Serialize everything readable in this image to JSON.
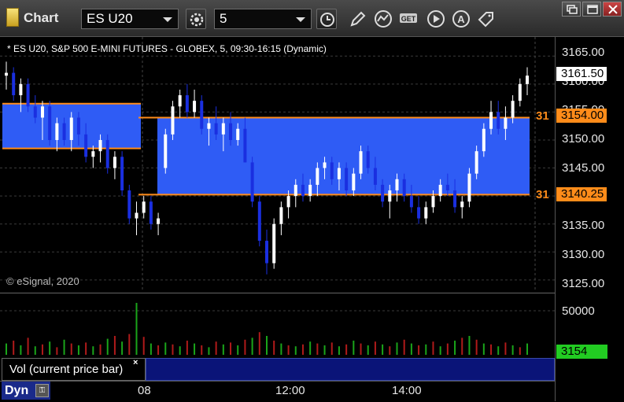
{
  "window": {
    "title": "Chart",
    "symbol": "ES U20",
    "interval": "5"
  },
  "toolbar": {
    "icons": [
      "gear-icon",
      "clock-icon",
      "pencil-icon",
      "study-icon",
      "get-icon",
      "play-icon",
      "alert-icon",
      "tag-icon"
    ]
  },
  "window_controls": [
    "restore-icon",
    "maximize-icon",
    "close-icon"
  ],
  "chart_header": "* ES U20, S&P 500 E-MINI FUTURES - GLOBEX, 5, 09:30-16:15 (Dynamic)",
  "watermark": "© eSignal, 2020",
  "price_axis": {
    "ticks": [
      "3165.00",
      "3160.00",
      "3155.00",
      "3150.00",
      "3145.00",
      "3140.00",
      "3135.00",
      "3130.00",
      "3125.00"
    ],
    "current_price": "3161.50",
    "level_high": "3154.00",
    "level_low": "3140.25",
    "level_left_high": "31",
    "level_left_low": "31"
  },
  "volume": {
    "label": "Vol (current price bar)",
    "close_glyph": "×",
    "tick": "50000",
    "current": "3154"
  },
  "time_axis": {
    "labels": [
      "08",
      "12:00",
      "14:00"
    ],
    "mode_label": "Dyn",
    "mode_icon": "lock-icon"
  },
  "colors": {
    "up": "#ffffff",
    "down": "#1a2fe0",
    "zone": "#2f5cf5",
    "level_line": "#ff8c1a",
    "vol_up": "#1aa51a",
    "vol_down": "#b01a1a",
    "current_price_bg": "#ffffff",
    "level_box_bg": "#ff8c1a",
    "vol_box_bg": "#22cc22"
  },
  "chart_data": {
    "type": "candlestick",
    "ylim": [
      3124,
      3167
    ],
    "zones": [
      {
        "top": 3156.5,
        "bottom": 3148.5,
        "segment": "prior"
      },
      {
        "top": 3154.0,
        "bottom": 3140.25,
        "segment": "current"
      }
    ],
    "candles": [
      [
        3161.5,
        3164,
        3159,
        3162
      ],
      [
        3162,
        3163,
        3157,
        3158
      ],
      [
        3158,
        3161,
        3155,
        3160
      ],
      [
        3160,
        3161,
        3155,
        3156
      ],
      [
        3156,
        3158,
        3153,
        3154
      ],
      [
        3154,
        3157,
        3150,
        3156
      ],
      [
        3156,
        3157,
        3149,
        3150
      ],
      [
        3150,
        3154,
        3148,
        3153
      ],
      [
        3153,
        3154,
        3149,
        3150
      ],
      [
        3150,
        3155,
        3148,
        3154
      ],
      [
        3154,
        3155,
        3149,
        3151
      ],
      [
        3151,
        3153,
        3146,
        3147
      ],
      [
        3147,
        3149,
        3145,
        3148
      ],
      [
        3148,
        3151,
        3146,
        3150
      ],
      [
        3150,
        3151,
        3144,
        3145
      ],
      [
        3145,
        3148,
        3143,
        3147
      ],
      [
        3147,
        3148,
        3140,
        3141
      ],
      [
        3141,
        3142,
        3135,
        3136
      ],
      [
        3136,
        3139,
        3133,
        3137
      ],
      [
        3137,
        3140,
        3136,
        3139
      ],
      [
        3139,
        3140,
        3134,
        3135
      ],
      [
        3135,
        3137,
        3133,
        3136
      ],
      [
        3145,
        3152,
        3144,
        3151
      ],
      [
        3151,
        3157,
        3150,
        3156
      ],
      [
        3156,
        3159,
        3154,
        3158
      ],
      [
        3158,
        3160,
        3154,
        3155
      ],
      [
        3155,
        3159,
        3154,
        3157
      ],
      [
        3157,
        3158,
        3151,
        3152
      ],
      [
        3152,
        3154,
        3149,
        3153
      ],
      [
        3153,
        3156,
        3150,
        3151
      ],
      [
        3151,
        3154,
        3148,
        3153
      ],
      [
        3153,
        3155,
        3149,
        3150
      ],
      [
        3150,
        3153,
        3149,
        3152
      ],
      [
        3152,
        3154,
        3146,
        3146
      ],
      [
        3146,
        3147,
        3138,
        3139
      ],
      [
        3139,
        3140,
        3131,
        3132
      ],
      [
        3132,
        3134,
        3126,
        3128
      ],
      [
        3128,
        3136,
        3127,
        3135
      ],
      [
        3135,
        3139,
        3133,
        3138
      ],
      [
        3138,
        3141,
        3136,
        3140
      ],
      [
        3140,
        3143,
        3138,
        3142
      ],
      [
        3142,
        3144,
        3139,
        3140
      ],
      [
        3140,
        3143,
        3139,
        3142
      ],
      [
        3142,
        3146,
        3140,
        3145
      ],
      [
        3145,
        3147,
        3143,
        3146
      ],
      [
        3146,
        3147,
        3142,
        3143
      ],
      [
        3143,
        3146,
        3141,
        3145
      ],
      [
        3145,
        3146,
        3140,
        3141
      ],
      [
        3141,
        3145,
        3140,
        3144
      ],
      [
        3144,
        3149,
        3143,
        3148
      ],
      [
        3148,
        3149,
        3144,
        3145
      ],
      [
        3145,
        3147,
        3141,
        3142
      ],
      [
        3142,
        3143,
        3138,
        3139
      ],
      [
        3139,
        3142,
        3136,
        3141
      ],
      [
        3141,
        3144,
        3139,
        3143
      ],
      [
        3143,
        3144,
        3139,
        3140
      ],
      [
        3140,
        3142,
        3137,
        3138
      ],
      [
        3138,
        3140,
        3135,
        3136
      ],
      [
        3136,
        3139,
        3135,
        3138
      ],
      [
        3138,
        3141,
        3137,
        3140
      ],
      [
        3140,
        3143,
        3139,
        3142
      ],
      [
        3142,
        3144,
        3140,
        3141
      ],
      [
        3141,
        3143,
        3137,
        3138
      ],
      [
        3138,
        3140,
        3136,
        3139
      ],
      [
        3139,
        3145,
        3138,
        3144
      ],
      [
        3144,
        3149,
        3143,
        3148
      ],
      [
        3148,
        3153,
        3147,
        3152
      ],
      [
        3152,
        3157,
        3151,
        3155
      ],
      [
        3155,
        3157,
        3151,
        3152
      ],
      [
        3152,
        3156,
        3150,
        3154
      ],
      [
        3154,
        3158,
        3153,
        3157
      ],
      [
        3157,
        3161,
        3156,
        3160
      ],
      [
        3160,
        3163,
        3158,
        3161.5
      ]
    ],
    "volume": [
      [
        12,
        1
      ],
      [
        15,
        0
      ],
      [
        10,
        1
      ],
      [
        18,
        0
      ],
      [
        9,
        1
      ],
      [
        11,
        0
      ],
      [
        14,
        1
      ],
      [
        8,
        0
      ],
      [
        16,
        1
      ],
      [
        12,
        0
      ],
      [
        10,
        1
      ],
      [
        13,
        0
      ],
      [
        9,
        1
      ],
      [
        11,
        0
      ],
      [
        17,
        1
      ],
      [
        20,
        0
      ],
      [
        14,
        1
      ],
      [
        22,
        0
      ],
      [
        55,
        1
      ],
      [
        19,
        0
      ],
      [
        12,
        1
      ],
      [
        10,
        0
      ],
      [
        13,
        1
      ],
      [
        11,
        0
      ],
      [
        9,
        1
      ],
      [
        15,
        0
      ],
      [
        12,
        1
      ],
      [
        10,
        0
      ],
      [
        8,
        1
      ],
      [
        14,
        0
      ],
      [
        11,
        1
      ],
      [
        13,
        0
      ],
      [
        10,
        1
      ],
      [
        16,
        0
      ],
      [
        18,
        1
      ],
      [
        24,
        0
      ],
      [
        20,
        1
      ],
      [
        15,
        0
      ],
      [
        12,
        1
      ],
      [
        10,
        0
      ],
      [
        9,
        1
      ],
      [
        11,
        0
      ],
      [
        14,
        1
      ],
      [
        12,
        0
      ],
      [
        10,
        1
      ],
      [
        13,
        0
      ],
      [
        9,
        1
      ],
      [
        11,
        0
      ],
      [
        15,
        1
      ],
      [
        12,
        0
      ],
      [
        10,
        1
      ],
      [
        14,
        0
      ],
      [
        11,
        1
      ],
      [
        9,
        0
      ],
      [
        13,
        1
      ],
      [
        16,
        0
      ],
      [
        12,
        1
      ],
      [
        10,
        0
      ],
      [
        11,
        1
      ],
      [
        14,
        0
      ],
      [
        9,
        1
      ],
      [
        12,
        0
      ],
      [
        15,
        1
      ],
      [
        18,
        0
      ],
      [
        20,
        1
      ],
      [
        16,
        0
      ],
      [
        12,
        1
      ],
      [
        11,
        0
      ],
      [
        9,
        1
      ],
      [
        13,
        0
      ],
      [
        10,
        1
      ],
      [
        8,
        0
      ],
      [
        12,
        1
      ]
    ]
  }
}
